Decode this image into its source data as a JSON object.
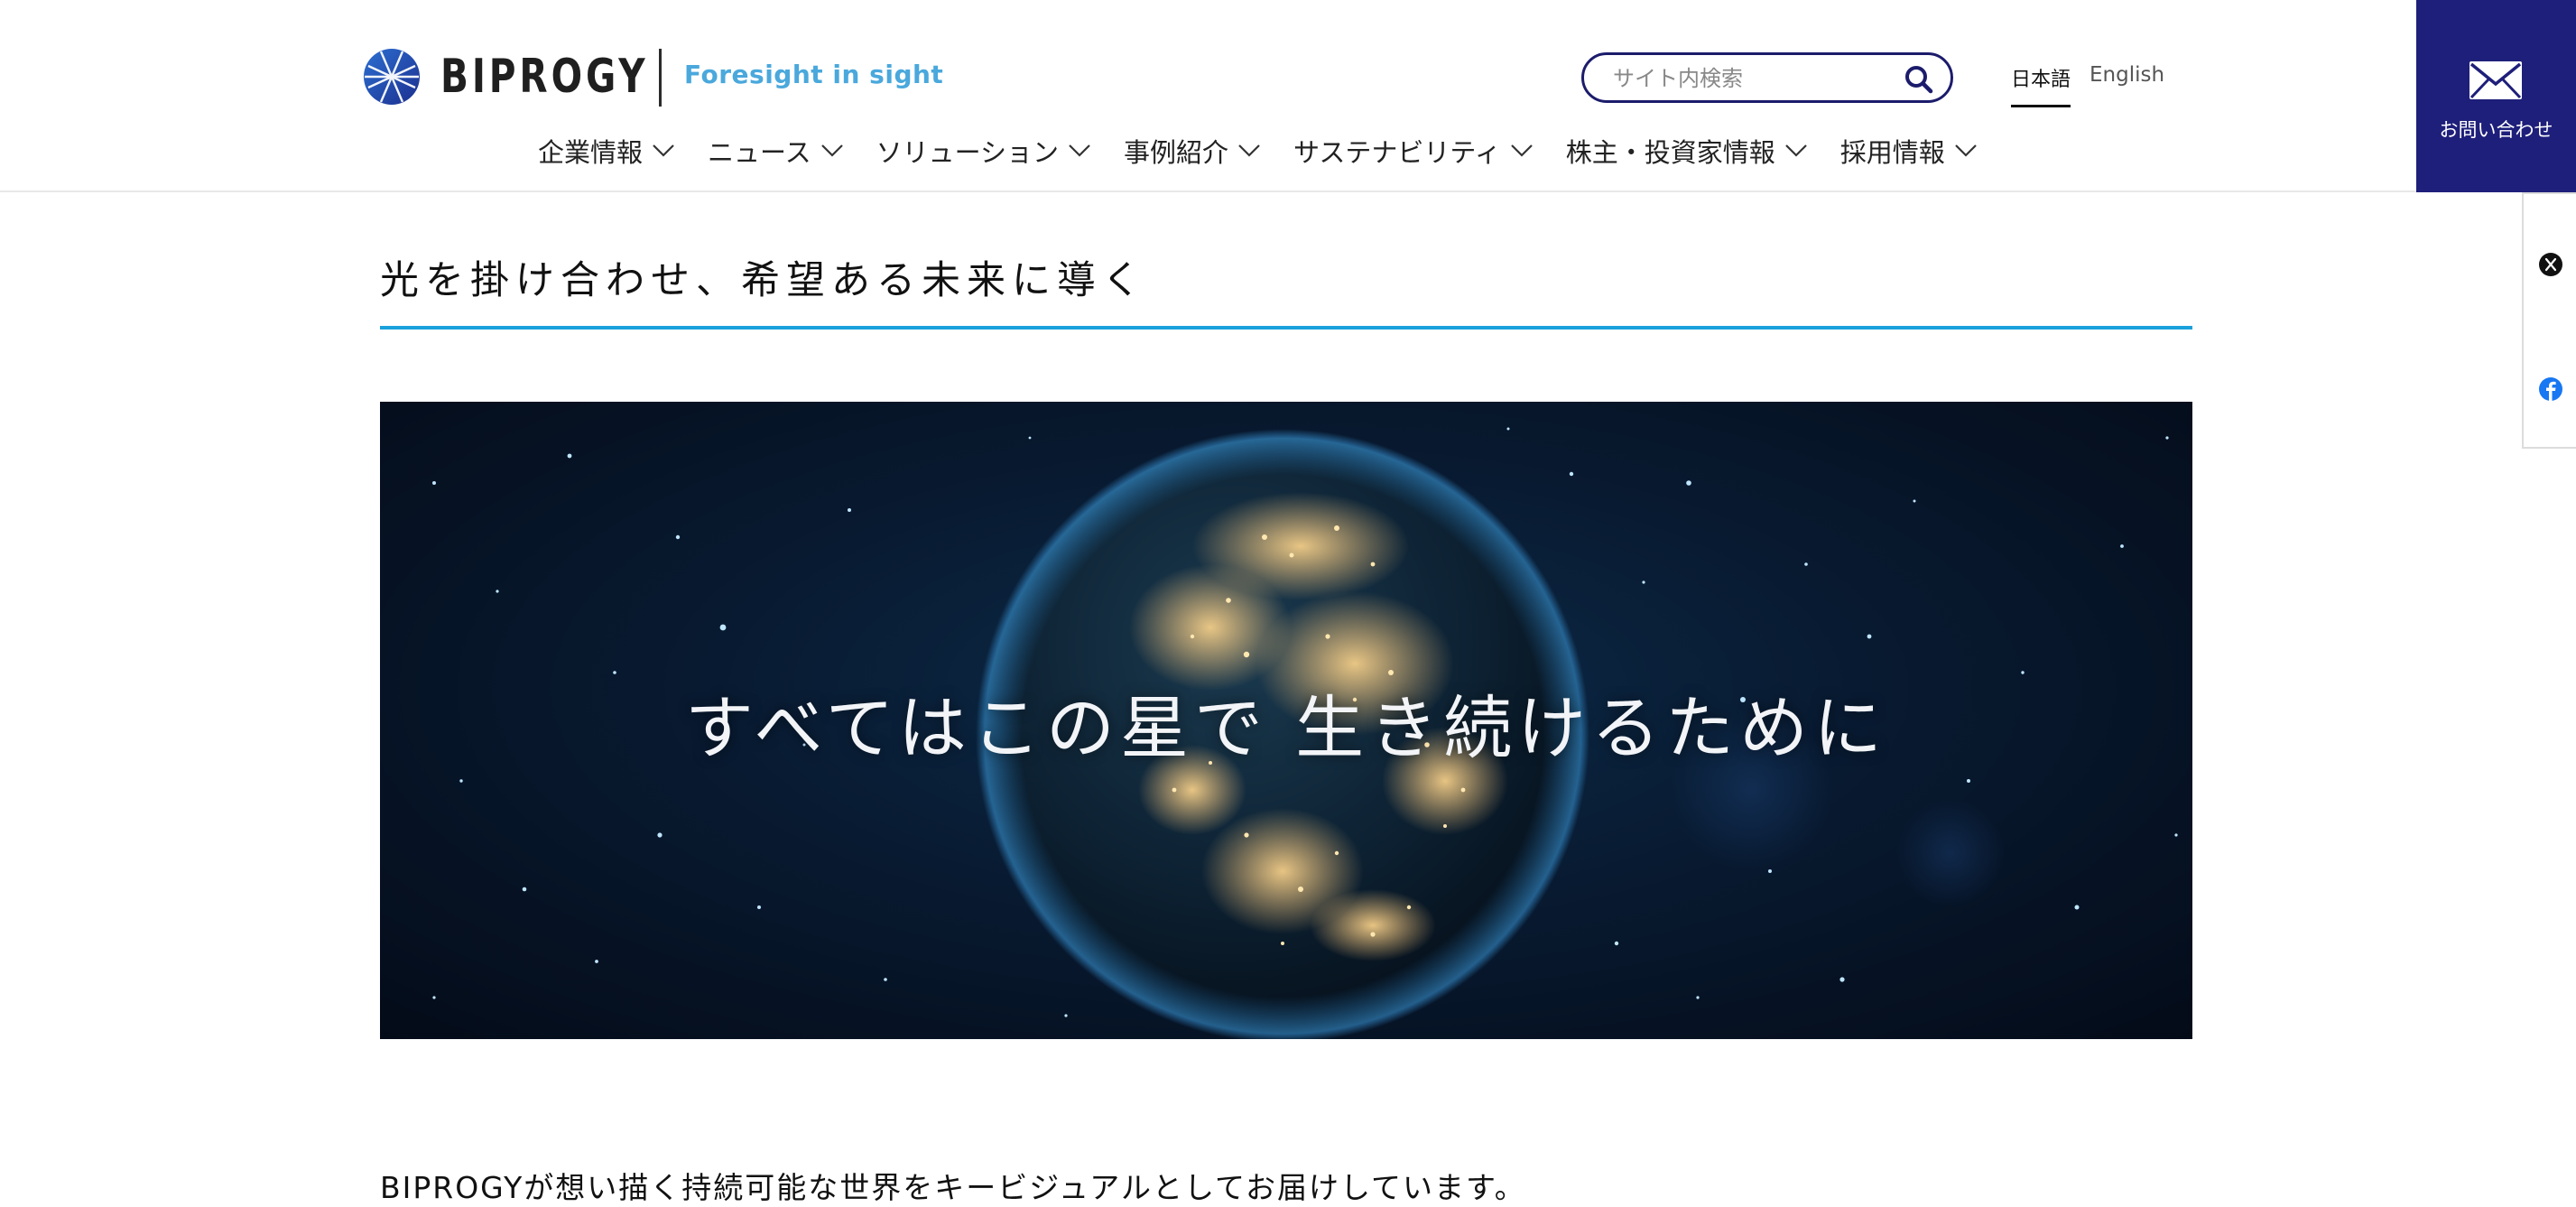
{
  "header": {
    "logo_text": "BIPROGY",
    "tagline": "Foresight in sight",
    "search_placeholder": "サイト内検索",
    "lang_ja": "日本語",
    "lang_en": "English",
    "contact_label": "お問い合わせ",
    "nav": [
      {
        "label": "企業情報"
      },
      {
        "label": "ニュース"
      },
      {
        "label": "ソリューション"
      },
      {
        "label": "事例紹介"
      },
      {
        "label": "サステナビリティ"
      },
      {
        "label": "株主・投資家情報"
      },
      {
        "label": "採用情報"
      }
    ]
  },
  "share": {
    "x_icon": "x-icon",
    "facebook_icon": "facebook-icon"
  },
  "main": {
    "title": "光を掛け合わせ、希望ある未来に導く",
    "hero_copy": "すべてはこの星で 生き続けるために",
    "intro": "BIPROGYが想い描く持続可能な世界をキービジュアルとしてお届けしています。"
  },
  "colors": {
    "brand_navy": "#1e1f7a",
    "accent_blue": "#1aa1dc",
    "tagline_blue": "#4aa8dc"
  }
}
